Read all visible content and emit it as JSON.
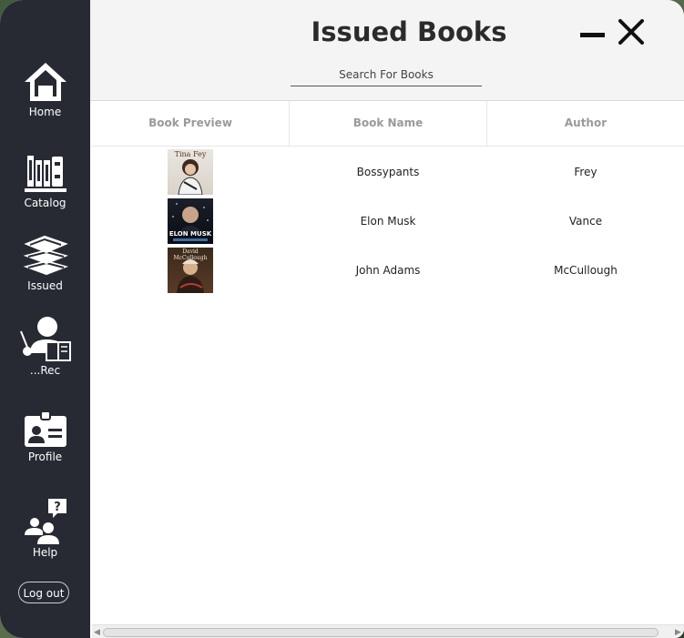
{
  "sidebar": {
    "items": [
      {
        "label": "Home",
        "icon": "home-icon"
      },
      {
        "label": "Catalog",
        "icon": "books-icon"
      },
      {
        "label": "Issued",
        "icon": "stack-icon"
      },
      {
        "label": "...Rec",
        "icon": "reader-icon"
      },
      {
        "label": "Profile",
        "icon": "id-card-icon"
      },
      {
        "label": "Help",
        "icon": "help-icon"
      }
    ],
    "logout_label": "Log out"
  },
  "header": {
    "title": "Issued Books",
    "search_placeholder": "Search For Books"
  },
  "window_controls": {
    "minimize_icon": "minimize-icon",
    "close_icon": "close-icon"
  },
  "table": {
    "columns": [
      "Book Preview",
      "Book Name",
      "Author"
    ],
    "rows": [
      {
        "cover_text": "Tina Fey",
        "name": "Bossypants",
        "author": "Frey"
      },
      {
        "cover_text": "ELON MUSK",
        "name": "Elon Musk",
        "author": "Vance"
      },
      {
        "cover_text": "David McCullough",
        "name": "John Adams",
        "author": "McCullough"
      }
    ]
  },
  "colors": {
    "sidebar": "#272a33",
    "header_bg": "#f4f4f4",
    "column_header_text": "#9a9a9a"
  }
}
